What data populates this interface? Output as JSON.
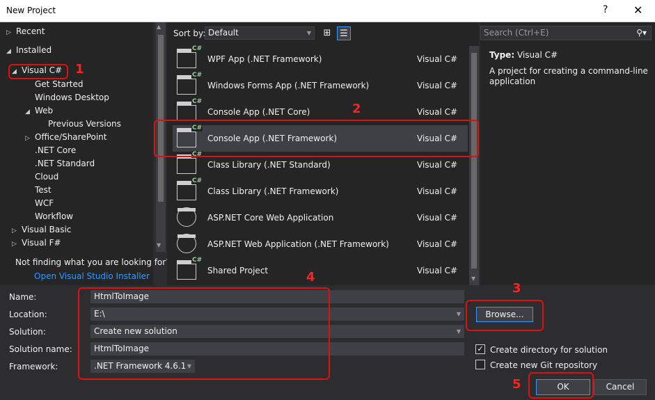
{
  "window": {
    "title": "New Project",
    "help_glyph": "?",
    "close_glyph": "✕"
  },
  "left_tree": {
    "items": [
      {
        "label": "Recent",
        "arrow": "▷"
      },
      {
        "label": "Installed",
        "arrow": "◢"
      },
      {
        "label": "Visual C#",
        "arrow": "◢"
      },
      {
        "label": "Get Started",
        "arrow": ""
      },
      {
        "label": "Windows Desktop",
        "arrow": ""
      },
      {
        "label": "Web",
        "arrow": "◢"
      },
      {
        "label": "Previous Versions",
        "arrow": ""
      },
      {
        "label": "Office/SharePoint",
        "arrow": "▷"
      },
      {
        "label": ".NET Core",
        "arrow": ""
      },
      {
        "label": ".NET Standard",
        "arrow": ""
      },
      {
        "label": "Cloud",
        "arrow": ""
      },
      {
        "label": "Test",
        "arrow": ""
      },
      {
        "label": "WCF",
        "arrow": ""
      },
      {
        "label": "Workflow",
        "arrow": ""
      },
      {
        "label": "Visual Basic",
        "arrow": "▷"
      },
      {
        "label": "Visual F#",
        "arrow": "▷"
      }
    ],
    "not_finding": "Not finding what you are looking for?",
    "installer_link": "Open Visual Studio Installer"
  },
  "sortbar": {
    "label": "Sort by:",
    "value": "Default"
  },
  "templates": [
    {
      "name": "WPF App (.NET Framework)",
      "lang": "Visual C#"
    },
    {
      "name": "Windows Forms App (.NET Framework)",
      "lang": "Visual C#"
    },
    {
      "name": "Console App (.NET Core)",
      "lang": "Visual C#"
    },
    {
      "name": "Console App (.NET Framework)",
      "lang": "Visual C#"
    },
    {
      "name": "Class Library (.NET Standard)",
      "lang": "Visual C#"
    },
    {
      "name": "Class Library (.NET Framework)",
      "lang": "Visual C#"
    },
    {
      "name": "ASP.NET Core Web Application",
      "lang": "Visual C#"
    },
    {
      "name": "ASP.NET Web Application (.NET Framework)",
      "lang": "Visual C#"
    },
    {
      "name": "Shared Project",
      "lang": "Visual C#"
    }
  ],
  "template_badge": "C#",
  "search": {
    "placeholder": "Search (Ctrl+E)"
  },
  "details": {
    "type_label": "Type:",
    "type_value": "Visual C#",
    "description": "A project for creating a command-line application"
  },
  "form": {
    "name_label": "Name:",
    "name_value": "HtmlToImage",
    "location_label": "Location:",
    "location_value": "E:\\",
    "solution_label": "Solution:",
    "solution_value": "Create new solution",
    "solution_name_label": "Solution name:",
    "solution_name_value": "HtmlToImage",
    "framework_label": "Framework:",
    "framework_value": ".NET Framework 4.6.1"
  },
  "buttons": {
    "browse": "Browse...",
    "ok": "OK",
    "cancel": "Cancel"
  },
  "checkboxes": {
    "create_directory": "Create directory for solution",
    "create_git": "Create new Git repository"
  },
  "annotations": [
    "1",
    "2",
    "3",
    "4",
    "5"
  ],
  "colors": {
    "accent": "#3399ff",
    "annotation": "#e01010",
    "background": "#2d2d30"
  }
}
